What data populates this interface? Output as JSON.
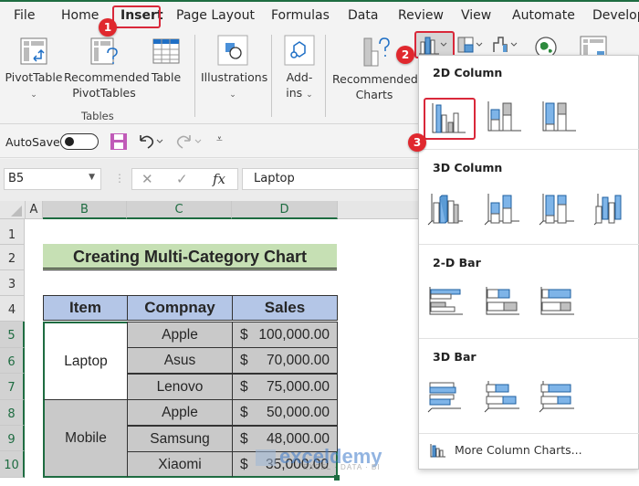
{
  "menu_tabs": [
    "File",
    "Home",
    "Insert",
    "Page Layout",
    "Formulas",
    "Data",
    "Review",
    "View",
    "Automate",
    "Develop"
  ],
  "active_tab": "Insert",
  "ribbon": {
    "pivottable": "PivotTable",
    "recommended_pivottables_1": "Recommended",
    "recommended_pivottables_2": "PivotTables",
    "table": "Table",
    "tables_group": "Tables",
    "illustrations": "Illustrations",
    "addins_1": "Add-",
    "addins_2": "ins",
    "recommended_charts_1": "Recommended",
    "recommended_charts_2": "Charts"
  },
  "badges": {
    "b1": "1",
    "b2": "2",
    "b3": "3"
  },
  "qat": {
    "autosave": "AutoSave",
    "autosave_state": "off"
  },
  "formula_bar": {
    "name_box": "B5",
    "fx": "fx",
    "formula": "Laptop"
  },
  "columns": [
    "A",
    "B",
    "C",
    "D"
  ],
  "rows": [
    "1",
    "2",
    "3",
    "4",
    "5",
    "6",
    "7",
    "8",
    "9",
    "10"
  ],
  "sheet": {
    "title": "Creating Multi-Category Chart",
    "headers": [
      "Item",
      "Compnay",
      "Sales"
    ],
    "groups": [
      {
        "item": "Laptop",
        "rows": [
          {
            "company": "Apple",
            "currency": "$",
            "sales": "100,000.00"
          },
          {
            "company": "Asus",
            "currency": "$",
            "sales": "70,000.00"
          },
          {
            "company": "Lenovo",
            "currency": "$",
            "sales": "75,000.00"
          }
        ]
      },
      {
        "item": "Mobile",
        "rows": [
          {
            "company": "Apple",
            "currency": "$",
            "sales": "50,000.00"
          },
          {
            "company": "Samsung",
            "currency": "$",
            "sales": "48,000.00"
          },
          {
            "company": "Xiaomi",
            "currency": "$",
            "sales": "35,000.00"
          }
        ]
      }
    ]
  },
  "dropdown": {
    "sections": [
      "2D Column",
      "3D Column",
      "2-D Bar",
      "3D Bar"
    ],
    "more": "More Column Charts..."
  },
  "watermark": {
    "brand": "exceldemy",
    "tagline": "EXCEL · DATA · BI"
  },
  "colors": {
    "accent_green": "#1e6c41",
    "highlight_red": "#d9283a",
    "chart_blue": "#5b9bd5"
  }
}
